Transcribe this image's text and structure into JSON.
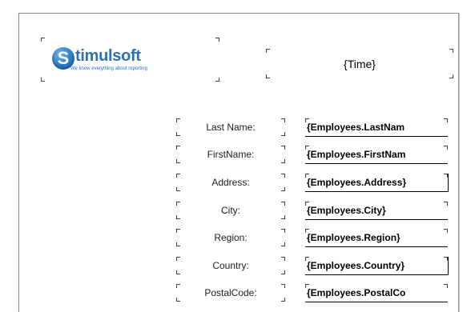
{
  "header": {
    "logo": {
      "first_letter": "S",
      "rest": "timulsoft",
      "tagline": "We know everything about reporting"
    },
    "time_field": "{Time}"
  },
  "rows": [
    {
      "label": "Last Name:",
      "field": "{Employees.LastNam"
    },
    {
      "label": "FirstName:",
      "field": "{Employees.FirstNam"
    },
    {
      "label": "Address:",
      "field": "{Employees.Address}"
    },
    {
      "label": "City:",
      "field": "{Employees.City}"
    },
    {
      "label": "Region:",
      "field": "{Employees.Region}"
    },
    {
      "label": "Country:",
      "field": "{Employees.Country}"
    },
    {
      "label": "PostalCode:",
      "field": "{Employees.PostalCo"
    }
  ]
}
